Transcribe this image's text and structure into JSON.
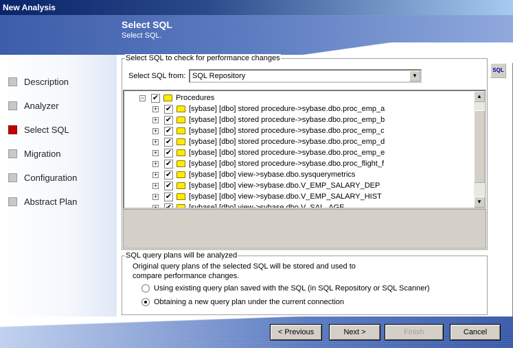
{
  "window": {
    "title": "New Analysis"
  },
  "header": {
    "title": "Select SQL",
    "subtitle": "Select SQL."
  },
  "steps": [
    {
      "label": "Description",
      "active": false
    },
    {
      "label": "Analyzer",
      "active": false
    },
    {
      "label": "Select SQL",
      "active": true
    },
    {
      "label": "Migration",
      "active": false
    },
    {
      "label": "Configuration",
      "active": false
    },
    {
      "label": "Abstract Plan",
      "active": false
    }
  ],
  "select_group": {
    "legend": "Select SQL to check for performance changes",
    "from_label": "Select SQL from:",
    "from_value": "SQL Repository",
    "sql_icon": "sql-icon"
  },
  "tree": {
    "root": {
      "label": "Procedures",
      "checked": true,
      "expanded": true
    },
    "items": [
      "[sybase] [dbo] stored procedure->sybase.dbo.proc_emp_a",
      "[sybase] [dbo] stored procedure->sybase.dbo.proc_emp_b",
      "[sybase] [dbo] stored procedure->sybase.dbo.proc_emp_c",
      "[sybase] [dbo] stored procedure->sybase.dbo.proc_emp_d",
      "[sybase] [dbo] stored procedure->sybase.dbo.proc_emp_e",
      "[sybase] [dbo] stored procedure->sybase.dbo.proc_flight_f",
      "[sybase] [dbo] view->sybase.dbo.sysquerymetrics",
      "[sybase] [dbo] view->sybase.dbo.V_EMP_SALARY_DEP",
      "[sybase] [dbo] view->sybase.dbo.V_EMP_SALARY_HIST",
      "[sybase] [dbo] view->sybase.dbo.V_SAL_AGE"
    ]
  },
  "plan_group": {
    "legend": "SQL query plans will be analyzed",
    "description": "Original query plans of the selected SQL will be stored and used to compare performance changes.",
    "options": [
      {
        "label": "Using existing query plan saved with the SQL (in SQL Repository or SQL Scanner)",
        "selected": false
      },
      {
        "label": "Obtaining a new query plan under the current connection",
        "selected": true
      }
    ]
  },
  "buttons": {
    "previous": "< Previous",
    "next": "Next >",
    "finish": "Finish",
    "cancel": "Cancel"
  }
}
